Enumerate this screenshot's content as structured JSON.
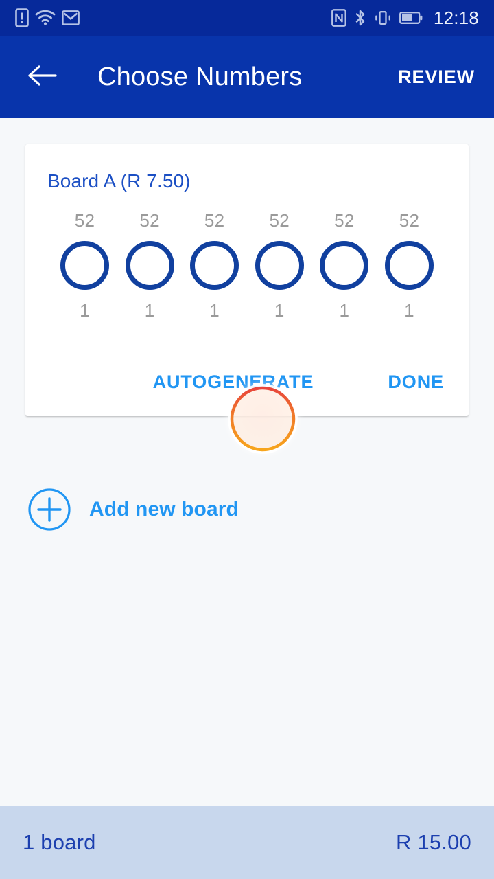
{
  "status_bar": {
    "icons_left": [
      "sim-alert-icon",
      "wifi-icon",
      "email-icon"
    ],
    "icons_right": [
      "nfc-icon",
      "bluetooth-icon",
      "vibrate-icon",
      "battery-icon"
    ],
    "time": "12:18",
    "background_color": "#06299a"
  },
  "app_bar": {
    "back_icon": "back-arrow-icon",
    "title": "Choose Numbers",
    "action_label": "REVIEW",
    "background_color": "#0834ab"
  },
  "board": {
    "title": "Board A (R 7.50)",
    "pickers": [
      {
        "max": "52",
        "value": "",
        "min": "1"
      },
      {
        "max": "52",
        "value": "",
        "min": "1"
      },
      {
        "max": "52",
        "value": "",
        "min": "1"
      },
      {
        "max": "52",
        "value": "",
        "min": "1"
      },
      {
        "max": "52",
        "value": "",
        "min": "1"
      },
      {
        "max": "52",
        "value": "",
        "min": "1"
      }
    ],
    "autogenerate_label": "AUTOGENERATE",
    "done_label": "DONE",
    "accent_color": "#2196f3",
    "circle_color": "#11409f"
  },
  "add_board": {
    "icon": "plus-circle-icon",
    "label": "Add new board",
    "color": "#2196f3"
  },
  "summary": {
    "boards_text": "1 board",
    "total_text": "R 15.00",
    "background_color": "#c8d7ed",
    "text_color": "#1c3faf"
  },
  "cursor": {
    "name": "tap-indicator",
    "ring_top_color": "#e8453c",
    "ring_bottom_color": "#f5a623"
  }
}
